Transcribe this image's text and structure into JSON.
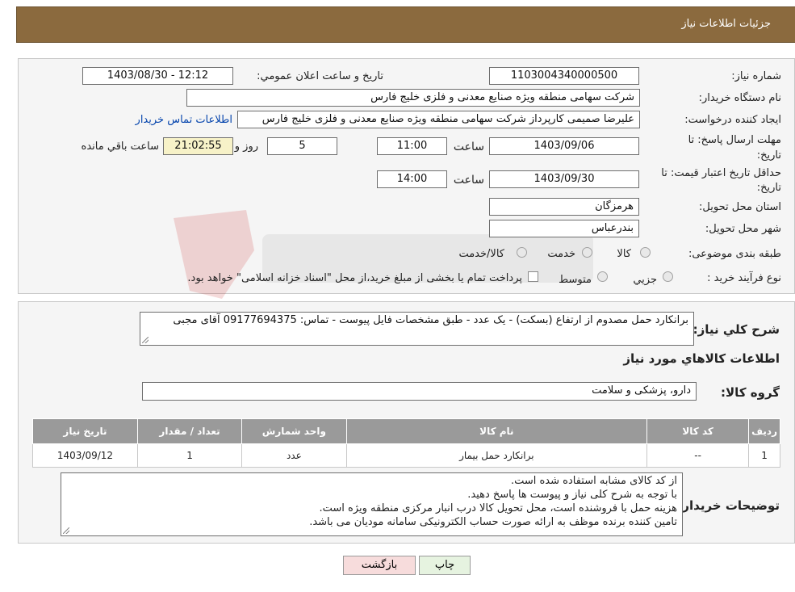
{
  "header": {
    "title": "جزئیات اطلاعات نیاز"
  },
  "form": {
    "need_number_label": "شماره نیاز:",
    "need_number": "1103004340000500",
    "announce_label": "تاریخ و ساعت اعلان عمومي:",
    "announce_value": "1403/08/30 - 12:12",
    "buyer_org_label": "نام دستگاه خریدار:",
    "buyer_org": "شرکت سهامی منطقه ویژه صنایع معدنی و فلزی خلیج فارس",
    "requester_label": "ایجاد کننده درخواست:",
    "requester": "علیرضا صمیمی کارپرداز شرکت سهامی منطقه ویژه صنایع معدنی و فلزی خلیج فارس",
    "contact_link": "اطلاعات تماس خریدار",
    "deadline_label": "مهلت ارسال پاسخ: تا تاریخ:",
    "deadline_date": "1403/09/06",
    "time_label": "ساعت",
    "deadline_time": "11:00",
    "days_value": "5",
    "days_label": "روز و",
    "remaining_time": "21:02:55",
    "remaining_label": "ساعت باقي مانده",
    "validity_label": "حداقل تاریخ اعتبار قیمت: تا تاریخ:",
    "validity_date": "1403/09/30",
    "validity_time": "14:00",
    "province_label": "استان محل تحویل:",
    "province": "هرمزگان",
    "city_label": "شهر محل تحویل:",
    "city": "بندرعباس",
    "category_label": "طبقه بندی موضوعی:",
    "category_options": [
      "کالا",
      "خدمت",
      "کالا/خدمت"
    ],
    "process_label": "نوع فرآیند خرید :",
    "process_options": [
      "جزيي",
      "متوسط"
    ],
    "payment_note": "پرداخت تمام یا بخشی از مبلغ خرید،از محل \"اسناد خزانه اسلامی\" خواهد بود."
  },
  "description": {
    "label": "شرح کلي نياز:",
    "text": "برانکارد حمل مصدوم از ارتفاع (بسکت) - یک عدد - طبق مشخصات فایل پیوست - تماس: 09177694375 آقای مجبی"
  },
  "goods": {
    "section_title": "اطلاعات کالاهاي مورد نياز",
    "group_label": "گروه کالا:",
    "group_value": "دارو، پزشکی و سلامت",
    "columns": [
      "رديف",
      "کد کالا",
      "نام کالا",
      "واحد شمارش",
      "تعداد / مقدار",
      "تاریخ نیاز"
    ],
    "rows": [
      [
        "1",
        "--",
        "برانکارد حمل بیمار",
        "عدد",
        "1",
        "1403/09/12"
      ]
    ]
  },
  "buyer_notes": {
    "label": "توضیحات خریدار:",
    "lines": [
      "از کد کالای مشابه استفاده شده است.",
      "با توجه به شرح کلی نیاز و پیوست ها پاسخ دهید.",
      "هزینه حمل با فروشنده است، محل تحویل کالا درب انبار مرکزی منطقه ویژه است.",
      "تامین کننده برنده موظف به ارائه صورت حساب الکترونیکی سامانه مودیان می باشد."
    ]
  },
  "buttons": {
    "print": "چاپ",
    "back": "بازگشت"
  },
  "colors": {
    "header": "#8b6a3e",
    "back_button": "#f7dcdc",
    "print_button": "#e6f3e0"
  }
}
